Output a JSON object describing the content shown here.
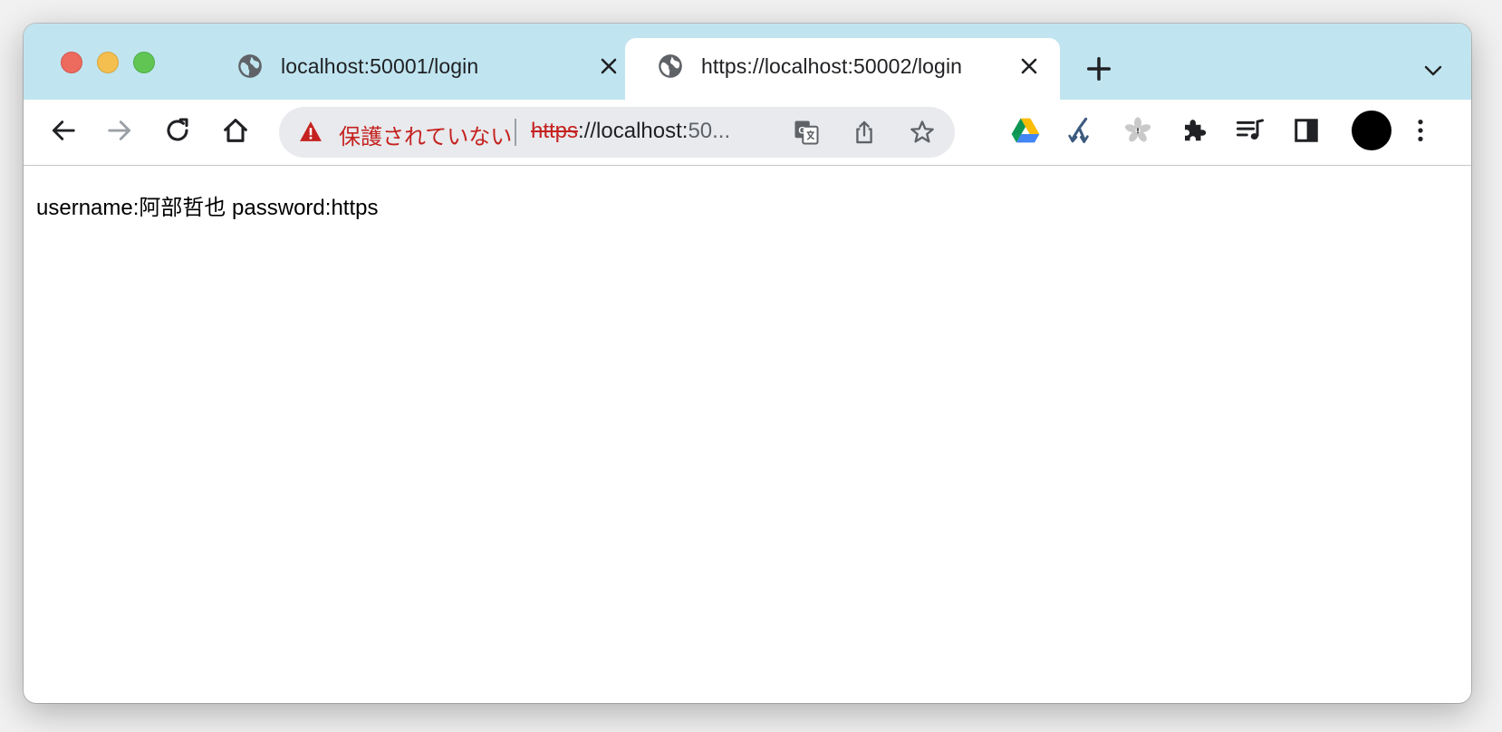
{
  "window": {
    "controls": [
      "close",
      "minimize",
      "zoom"
    ]
  },
  "tabs": [
    {
      "title": "localhost:50001/login",
      "active": false,
      "icon": "globe-icon"
    },
    {
      "title": "https://localhost:50002/login",
      "active": true,
      "icon": "globe-icon"
    }
  ],
  "toolbar": {
    "back_icon": "arrow-left-icon",
    "forward_icon": "arrow-right-icon",
    "reload_icon": "reload-icon",
    "home_icon": "home-icon",
    "omnibox": {
      "security_label": "保護されていない",
      "url_scheme": "https",
      "url_host": "://localhost:",
      "url_rest": "50..."
    },
    "extensions": [
      "translate-icon",
      "share-icon",
      "bookmark-star-icon",
      "google-drive-icon",
      "fork-icon",
      "sakura-icon",
      "puzzle-icon",
      "media-queue-icon",
      "side-panel-icon",
      "profile-avatar",
      "more-menu-icon"
    ]
  },
  "page": {
    "body_text": "username:阿部哲也 password:https"
  },
  "colors": {
    "tabstrip": "#c0e5f0",
    "warning": "#c5221f",
    "omnibox_bg": "#e8eaed"
  }
}
